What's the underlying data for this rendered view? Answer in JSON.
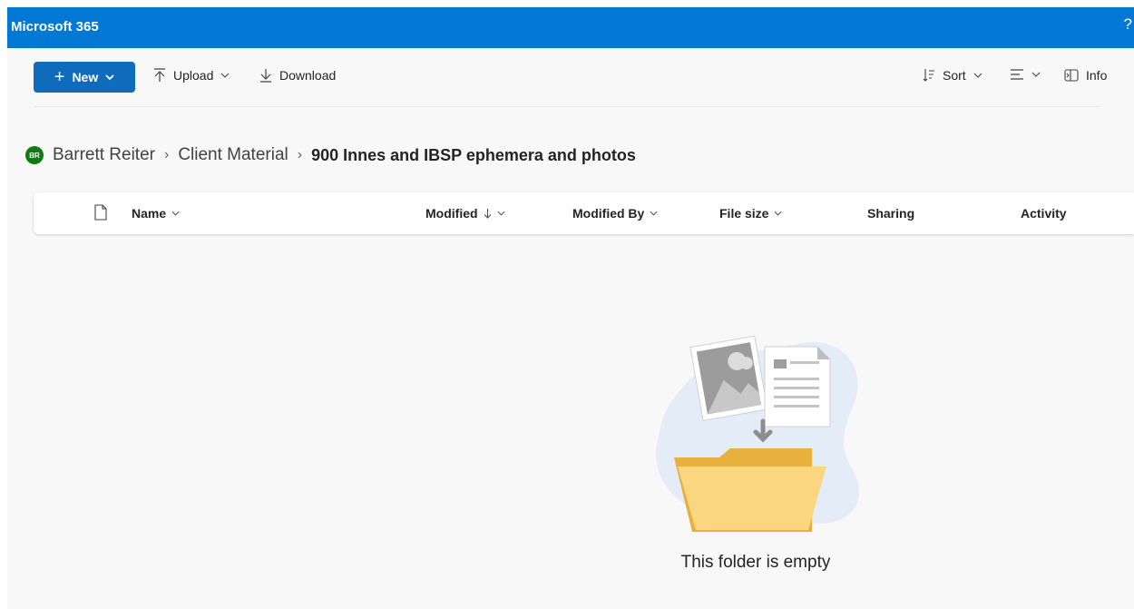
{
  "app": {
    "title": "Microsoft 365",
    "help_label": "?"
  },
  "toolbar": {
    "new_label": "New",
    "upload_label": "Upload",
    "download_label": "Download",
    "sort_label": "Sort",
    "info_label": "Info"
  },
  "breadcrumb": {
    "avatar_initials": "BR",
    "items": [
      "Barrett Reiter",
      "Client Material",
      "900 Innes and IBSP ephemera and photos"
    ]
  },
  "columns": {
    "name": "Name",
    "modified": "Modified",
    "modified_by": "Modified By",
    "file_size": "File size",
    "sharing": "Sharing",
    "activity": "Activity"
  },
  "empty_state": {
    "message": "This folder is empty"
  },
  "colors": {
    "brand_blue": "#0078d4",
    "button_blue": "#0f6cbd",
    "avatar_green": "#107c10",
    "folder_yellow": "#f9d67f"
  },
  "icons": {
    "upload": "arrow-up-icon",
    "download": "arrow-down-icon",
    "sort": "sort-icon",
    "view": "view-options-icon",
    "info": "info-pane-icon",
    "file_type": "file-icon"
  }
}
